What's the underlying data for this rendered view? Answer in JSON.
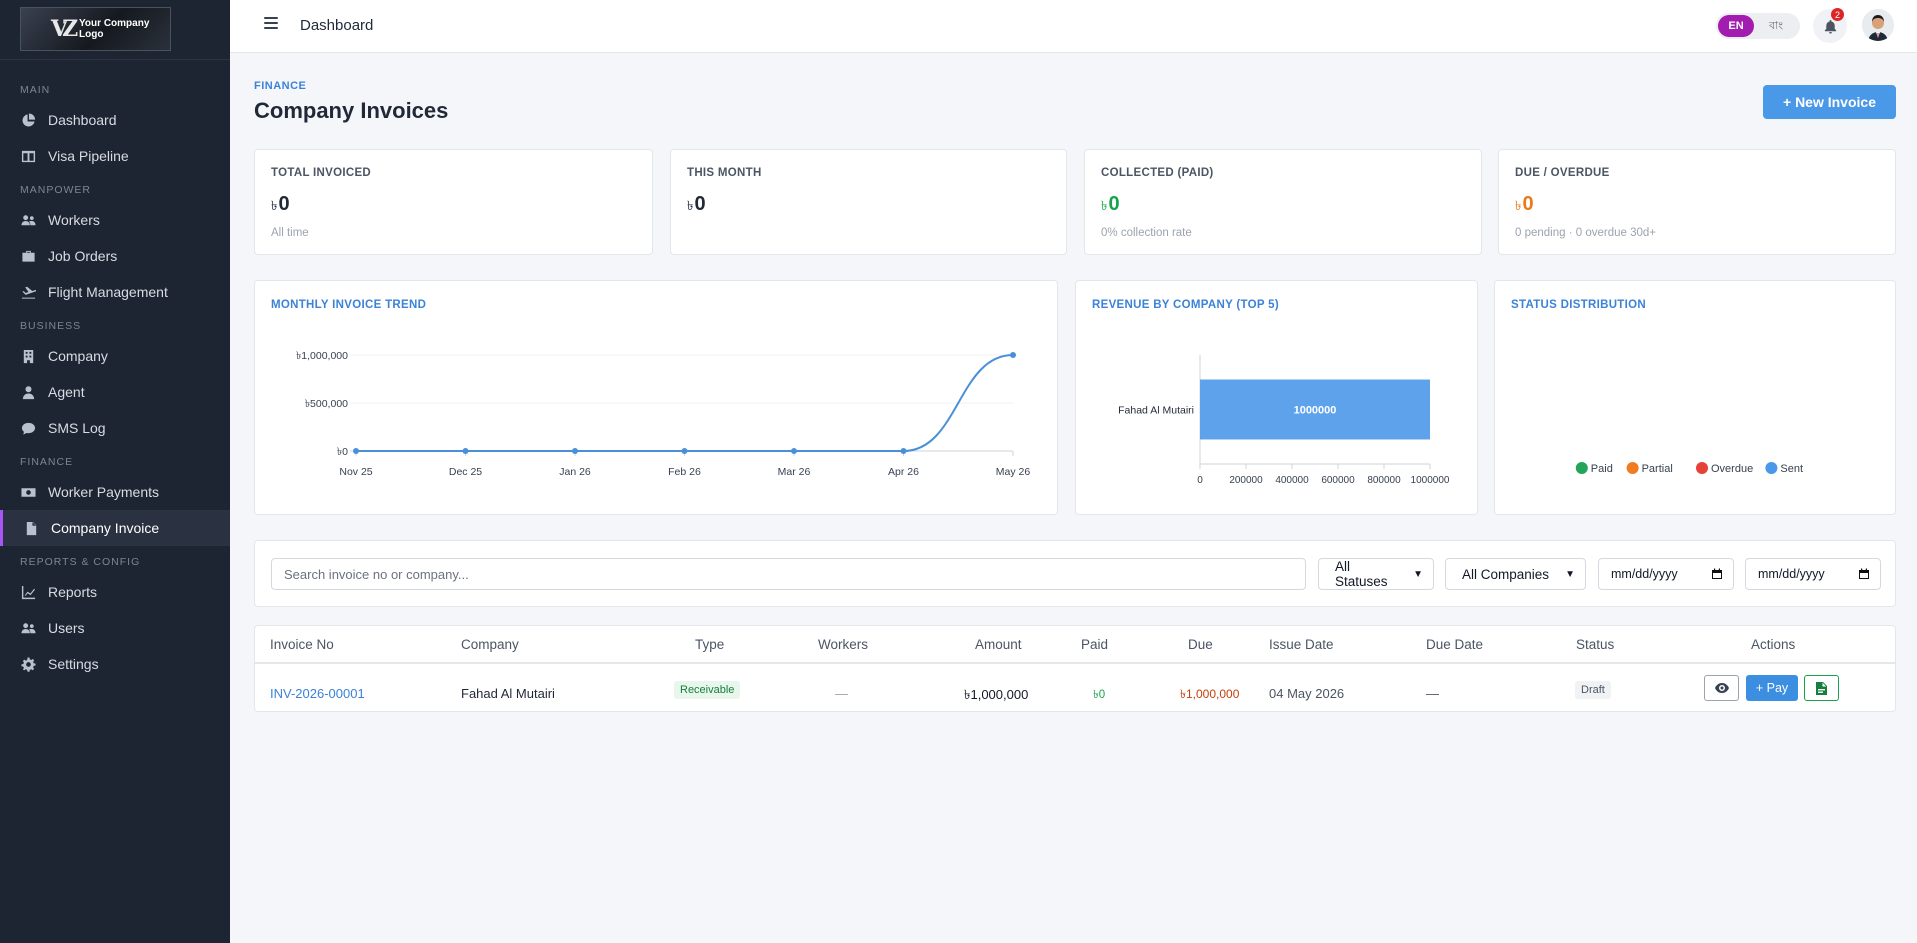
{
  "brand": {
    "logo_text_line1": "Your Company",
    "logo_text_line2": "Logo"
  },
  "sidebar": {
    "sections": [
      {
        "title": "MAIN",
        "items": [
          {
            "label": "Dashboard",
            "icon": "pie-chart-icon"
          },
          {
            "label": "Visa Pipeline",
            "icon": "columns-icon"
          }
        ]
      },
      {
        "title": "MANPOWER",
        "items": [
          {
            "label": "Workers",
            "icon": "users-icon"
          },
          {
            "label": "Job Orders",
            "icon": "briefcase-icon"
          },
          {
            "label": "Flight Management",
            "icon": "plane-icon"
          }
        ]
      },
      {
        "title": "BUSINESS",
        "items": [
          {
            "label": "Company",
            "icon": "building-icon"
          },
          {
            "label": "Agent",
            "icon": "user-tie-icon"
          },
          {
            "label": "SMS Log",
            "icon": "sms-icon"
          }
        ]
      },
      {
        "title": "FINANCE",
        "items": [
          {
            "label": "Worker Payments",
            "icon": "money-icon"
          },
          {
            "label": "Company Invoice",
            "icon": "invoice-icon",
            "active": true
          }
        ]
      },
      {
        "title": "REPORTS & CONFIG",
        "items": [
          {
            "label": "Reports",
            "icon": "chart-line-icon"
          },
          {
            "label": "Users",
            "icon": "users-cog-icon"
          },
          {
            "label": "Settings",
            "icon": "gear-icon"
          }
        ]
      }
    ]
  },
  "topbar": {
    "title": "Dashboard",
    "lang_en": "EN",
    "lang_bn": "বাং",
    "notification_count": "2"
  },
  "page": {
    "breadcrumb": "FINANCE",
    "title": "Company Invoices",
    "new_button": "+ New Invoice"
  },
  "stats": [
    {
      "label": "TOTAL INVOICED",
      "currency": "৳",
      "value": "0",
      "sub": "All time",
      "color": "#111827"
    },
    {
      "label": "THIS MONTH",
      "currency": "৳",
      "value": "0",
      "sub": "",
      "color": "#111827"
    },
    {
      "label": "COLLECTED (PAID)",
      "currency": "৳",
      "value": "0",
      "sub": "0% collection rate",
      "color": "#16a34a"
    },
    {
      "label": "DUE / OVERDUE",
      "currency": "৳",
      "value": "0",
      "sub": "0 pending · 0 overdue 30d+",
      "color": "#ea7a17"
    }
  ],
  "panels": {
    "trend_title": "MONTHLY INVOICE TREND",
    "revenue_title": "REVENUE BY COMPANY (TOP 5)",
    "status_title": "STATUS DISTRIBUTION"
  },
  "chart_data": [
    {
      "type": "line",
      "title": "MONTHLY INVOICE TREND",
      "categories": [
        "Nov 25",
        "Dec 25",
        "Jan 26",
        "Feb 26",
        "Mar 26",
        "Apr 26",
        "May 26"
      ],
      "values": [
        0,
        0,
        0,
        0,
        0,
        0,
        1000000
      ],
      "ylim": [
        0,
        1000000
      ],
      "yticks": [
        "৳0",
        "৳500,000",
        "৳1,000,000"
      ],
      "color": "#4a90d9"
    },
    {
      "type": "bar",
      "orientation": "horizontal",
      "title": "REVENUE BY COMPANY (TOP 5)",
      "categories": [
        "Fahad Al Mutairi"
      ],
      "values": [
        1000000
      ],
      "xlim": [
        0,
        1000000
      ],
      "xticks": [
        "0",
        "200000",
        "400000",
        "600000",
        "800000",
        "1000000"
      ],
      "color": "#5ea2ec"
    },
    {
      "type": "pie",
      "title": "STATUS DISTRIBUTION",
      "legend": [
        {
          "name": "Paid",
          "color": "#22a55a"
        },
        {
          "name": "Partial",
          "color": "#f07c22"
        },
        {
          "name": "Overdue",
          "color": "#e5433a"
        },
        {
          "name": "Sent",
          "color": "#4a98e8"
        }
      ],
      "values": [
        0,
        0,
        0,
        0
      ]
    }
  ],
  "filters": {
    "search_placeholder": "Search invoice no or company...",
    "status_select": "All Statuses",
    "company_select": "All Companies",
    "date_from": "mm/dd/yyyy",
    "date_to": "mm/dd/yyyy"
  },
  "table": {
    "headers": [
      "Invoice No",
      "Company",
      "Type",
      "Workers",
      "Amount",
      "Paid",
      "Due",
      "Issue Date",
      "Due Date",
      "Status",
      "Actions"
    ],
    "rows": [
      {
        "invoice_no": "INV-2026-00001",
        "company": "Fahad Al Mutairi",
        "type": "Receivable",
        "workers": "—",
        "amount": "৳1,000,000",
        "paid": "৳0",
        "due": "৳1,000,000",
        "issue_date": "04 May 2026",
        "due_date": "—",
        "status": "Draft",
        "pay_label": "+ Pay"
      }
    ]
  }
}
